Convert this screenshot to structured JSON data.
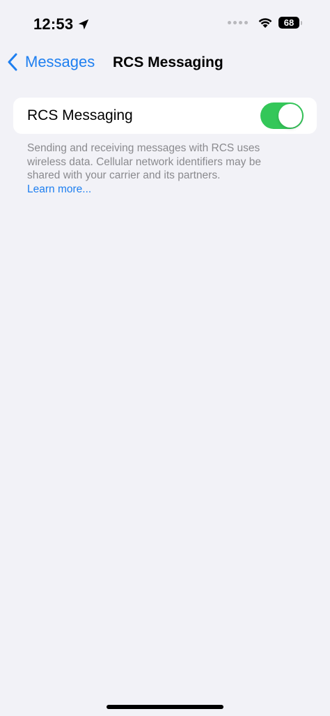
{
  "status_bar": {
    "time": "12:53",
    "battery_level": "68",
    "icons": [
      "location-arrow-icon",
      "signal-dots-icon",
      "wifi-icon",
      "battery-icon"
    ]
  },
  "nav": {
    "back_label": "Messages",
    "title": "RCS Messaging"
  },
  "settings": {
    "rcs_row_label": "RCS Messaging",
    "rcs_enabled": true,
    "footer_text": "Sending and receiving messages with RCS uses wireless data. Cellular network identifiers may be shared with your carrier and its partners.",
    "learn_more": "Learn more..."
  },
  "colors": {
    "accent": "#1e7ff0",
    "toggle_on": "#34c759",
    "background": "#f2f2f7",
    "footer_gray": "#8a8a8e"
  }
}
